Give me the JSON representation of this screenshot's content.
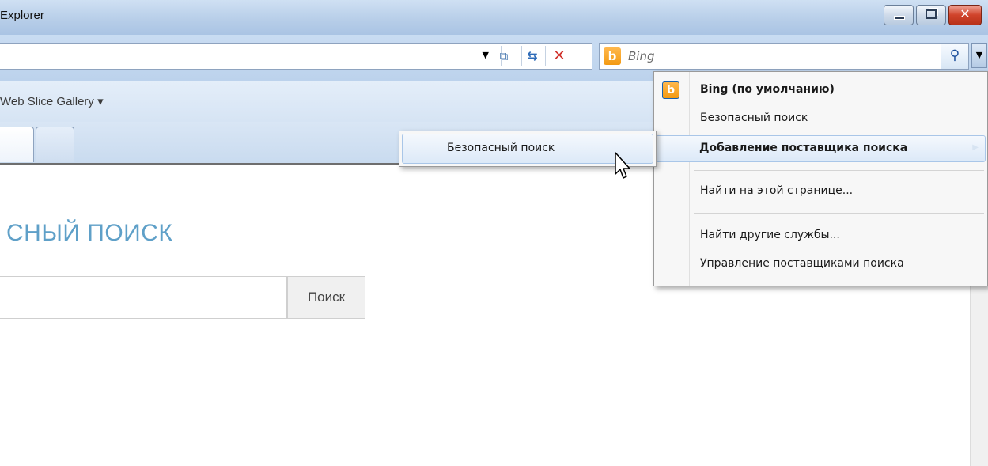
{
  "window": {
    "title": "Explorer",
    "buttons": {
      "minimize": "minimize",
      "maximize": "restore",
      "close": "✕"
    }
  },
  "address_bar": {
    "value": "",
    "icons": [
      "dropdown-arrow-icon",
      "compatibility-view-icon",
      "refresh-icon",
      "stop-icon"
    ]
  },
  "search_box": {
    "provider_logo": "b",
    "placeholder": "Bing",
    "button_icon": "magnifier-icon"
  },
  "favorites_bar": {
    "item": "Web Slice Gallery ▾"
  },
  "page": {
    "heading": "СНЫЙ ПОИСК",
    "search_input_value": "",
    "search_button": "Поиск"
  },
  "search_menu": {
    "items": [
      {
        "label": "Bing (по умолчанию)",
        "bold": true,
        "icon": "bing-icon"
      },
      {
        "label": "Безопасный поиск",
        "bold": false
      },
      {
        "label": "Добавление поставщика поиска",
        "bold": true,
        "highlighted": true,
        "has_submenu": true
      },
      {
        "label": "Найти на этой странице...",
        "bold": false
      },
      {
        "label": "Найти другие службы...",
        "bold": false
      },
      {
        "label": "Управление поставщиками поиска",
        "bold": false
      }
    ]
  },
  "submenu": {
    "items": [
      {
        "label": "Безопасный поиск",
        "highlighted": true
      }
    ]
  },
  "colors": {
    "accent_heading": "#5fa0c8",
    "bing_orange": "#f39a12",
    "stop_red": "#d0302a"
  }
}
